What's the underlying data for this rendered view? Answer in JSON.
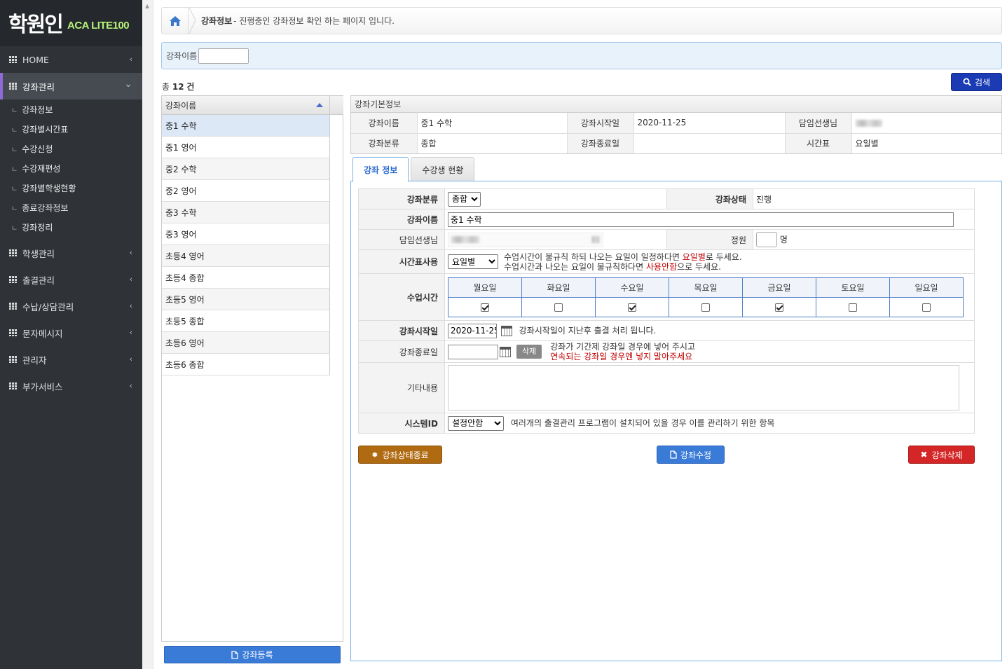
{
  "app": {
    "brand": "학원인",
    "edition": "ACA LITE100"
  },
  "sidebar": {
    "items": [
      {
        "label": "HOME"
      },
      {
        "label": "강좌관리"
      },
      {
        "label": "학생관리"
      },
      {
        "label": "출결관리"
      },
      {
        "label": "수납/상담관리"
      },
      {
        "label": "문자메시지"
      },
      {
        "label": "관리자"
      },
      {
        "label": "부가서비스"
      }
    ],
    "subitems": [
      "강좌정보",
      "강좌별시간표",
      "수강신청",
      "수강재편성",
      "강좌별학생현황",
      "종료강좌정보",
      "강좌정리"
    ]
  },
  "breadcrumb": {
    "title": "강좌정보",
    "desc": "- 진행중인 강좌정보 확인 하는 페이지 입니다."
  },
  "search": {
    "label": "강좌이름",
    "value": "",
    "button": "검색"
  },
  "list": {
    "total_prefix": "총",
    "total_count": "12",
    "total_suffix": "건",
    "header": "강좌이름",
    "rows": [
      "중1 수학",
      "중1 영어",
      "중2 수학",
      "중2 영어",
      "중3 수학",
      "중3 영어",
      "초등4 영어",
      "초등4 종합",
      "초등5 영어",
      "초등5 종합",
      "초등6 영어",
      "초등6 종합"
    ],
    "register_button": "강좌등록"
  },
  "basic_info": {
    "caption": "강좌기본정보",
    "name_label": "강좌이름",
    "name_value": "중1 수학",
    "start_label": "강좌시작일",
    "start_value": "2020-11-25",
    "teacher_label": "담임선생님",
    "category_label": "강좌분류",
    "category_value": "종합",
    "end_label": "강좌종료일",
    "end_value": "",
    "timetable_label": "시간표",
    "timetable_value": "요일별"
  },
  "tabs": [
    "강좌 정보",
    "수강생 현황"
  ],
  "detail": {
    "category_label": "강좌분류",
    "category_selected": "종합",
    "status_label": "강좌상태",
    "status_value": "진행",
    "name_label": "강좌이름",
    "name_value": "중1 수학",
    "teacher_label": "담임선생님",
    "capacity_label": "정원",
    "capacity_value": "",
    "capacity_unit": "명",
    "timetable_label": "시간표사용",
    "timetable_selected": "요일별",
    "timetable_note1_a": "수업시간이 불규칙 하되 나오는 요일이 일정하다면 ",
    "timetable_note1_b": "요일별",
    "timetable_note1_c": "로 두세요.",
    "timetable_note2_a": "수업시간과 나오는 요일이 불규칙하다면 ",
    "timetable_note2_b": "사용안함",
    "timetable_note2_c": "으로 두세요.",
    "class_time_label": "수업시간",
    "days": [
      {
        "label": "월요일",
        "checked": true
      },
      {
        "label": "화요일",
        "checked": false
      },
      {
        "label": "수요일",
        "checked": true
      },
      {
        "label": "목요일",
        "checked": false
      },
      {
        "label": "금요일",
        "checked": true
      },
      {
        "label": "토요일",
        "checked": false
      },
      {
        "label": "일요일",
        "checked": false
      }
    ],
    "start_label": "강좌시작일",
    "start_value": "2020-11-25",
    "start_note": "강좌시작일이 지난후 출결 처리 됩니다.",
    "end_label": "강좌종료일",
    "end_value": "",
    "end_delete": "삭제",
    "end_note1": "강좌가 기간제 강좌일 경우에 넣어 주시고",
    "end_note2": "연속되는 강좌일 경우엔 넣지 말아주세요",
    "etc_label": "기타내용",
    "system_label": "시스템ID",
    "system_selected": "설정안함",
    "system_note": "여러개의 출결관리 프로그램이 설치되어 있을 경우 이를 관리하기 위한 항목"
  },
  "buttons": {
    "end": "강좌상태종료",
    "edit": "강좌수정",
    "delete": "강좌삭제"
  }
}
